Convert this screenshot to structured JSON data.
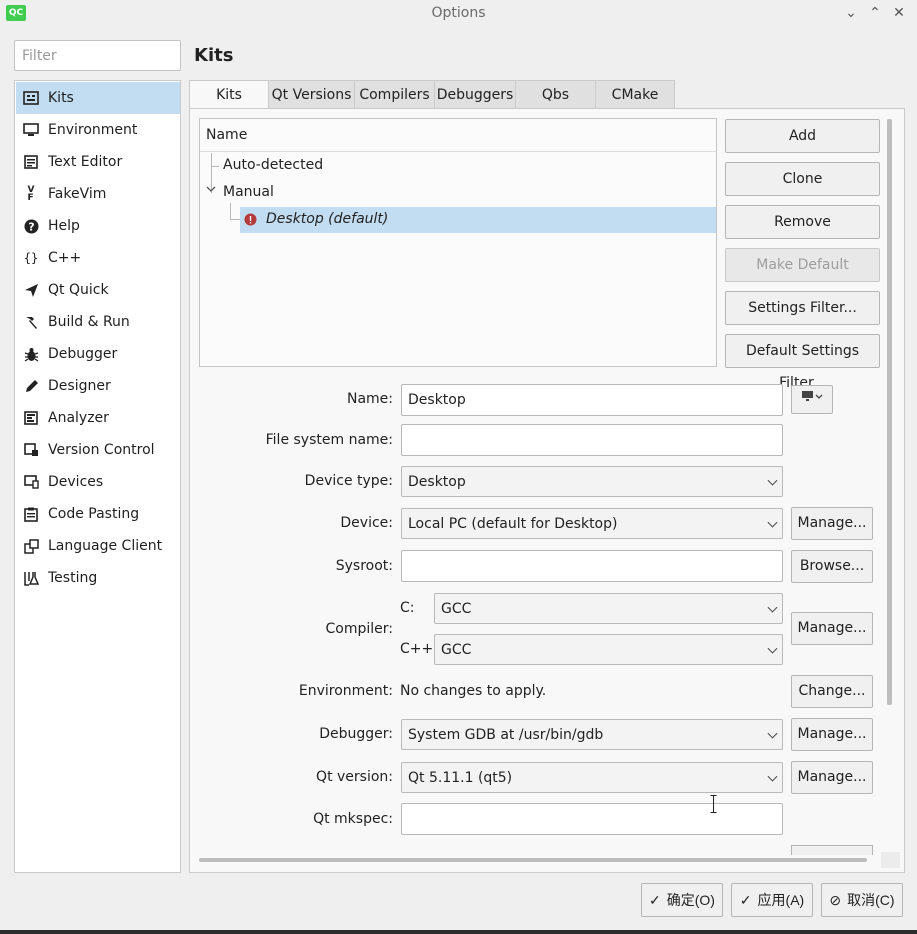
{
  "window": {
    "title": "Options",
    "app_icon": "QC"
  },
  "filter": {
    "placeholder": "Filter"
  },
  "sidebar": {
    "items": [
      {
        "label": "Kits",
        "icon": "kits-icon",
        "selected": true
      },
      {
        "label": "Environment",
        "icon": "monitor-icon"
      },
      {
        "label": "Text Editor",
        "icon": "text-editor-icon"
      },
      {
        "label": "FakeVim",
        "icon": "fakevim-icon"
      },
      {
        "label": "Help",
        "icon": "help-icon"
      },
      {
        "label": "C++",
        "icon": "braces-icon"
      },
      {
        "label": "Qt Quick",
        "icon": "paper-plane-icon"
      },
      {
        "label": "Build & Run",
        "icon": "hammer-icon"
      },
      {
        "label": "Debugger",
        "icon": "bug-icon"
      },
      {
        "label": "Designer",
        "icon": "pencil-icon"
      },
      {
        "label": "Analyzer",
        "icon": "analyzer-icon"
      },
      {
        "label": "Version Control",
        "icon": "version-control-icon"
      },
      {
        "label": "Devices",
        "icon": "devices-icon"
      },
      {
        "label": "Code Pasting",
        "icon": "clipboard-icon"
      },
      {
        "label": "Language Client",
        "icon": "language-client-icon"
      },
      {
        "label": "Testing",
        "icon": "flask-icon"
      }
    ]
  },
  "page": {
    "title": "Kits"
  },
  "tabs": [
    "Kits",
    "Qt Versions",
    "Compilers",
    "Debuggers",
    "Qbs",
    "CMake"
  ],
  "tree": {
    "header": "Name",
    "auto_detected": "Auto-detected",
    "manual": "Manual",
    "kit": "Desktop (default)"
  },
  "kit_buttons": {
    "add": "Add",
    "clone": "Clone",
    "remove": "Remove",
    "make_default": "Make Default",
    "settings_filter": "Settings Filter...",
    "default_settings_filter": "Default Settings Filter..."
  },
  "form": {
    "name_label": "Name:",
    "name_value": "Desktop",
    "fs_name_label": "File system name:",
    "fs_name_value": "",
    "device_type_label": "Device type:",
    "device_type_value": "Desktop",
    "device_label": "Device:",
    "device_value": "Local PC (default for Desktop)",
    "sysroot_label": "Sysroot:",
    "sysroot_value": "",
    "compiler_label": "Compiler:",
    "c_label": "C:",
    "c_value": "GCC",
    "cpp_label": "C++:",
    "cpp_value": "GCC",
    "environment_label": "Environment:",
    "environment_value": "No changes to apply.",
    "debugger_label": "Debugger:",
    "debugger_value": "System GDB at /usr/bin/gdb",
    "qt_version_label": "Qt version:",
    "qt_version_value": "Qt 5.11.1 (qt5)",
    "qt_mkspec_label": "Qt mkspec:",
    "qt_mkspec_value": ""
  },
  "side_buttons": {
    "manage": "Manage...",
    "browse": "Browse...",
    "change": "Change..."
  },
  "dialog": {
    "ok": "确定(O)",
    "apply": "应用(A)",
    "cancel": "取消(C)"
  }
}
